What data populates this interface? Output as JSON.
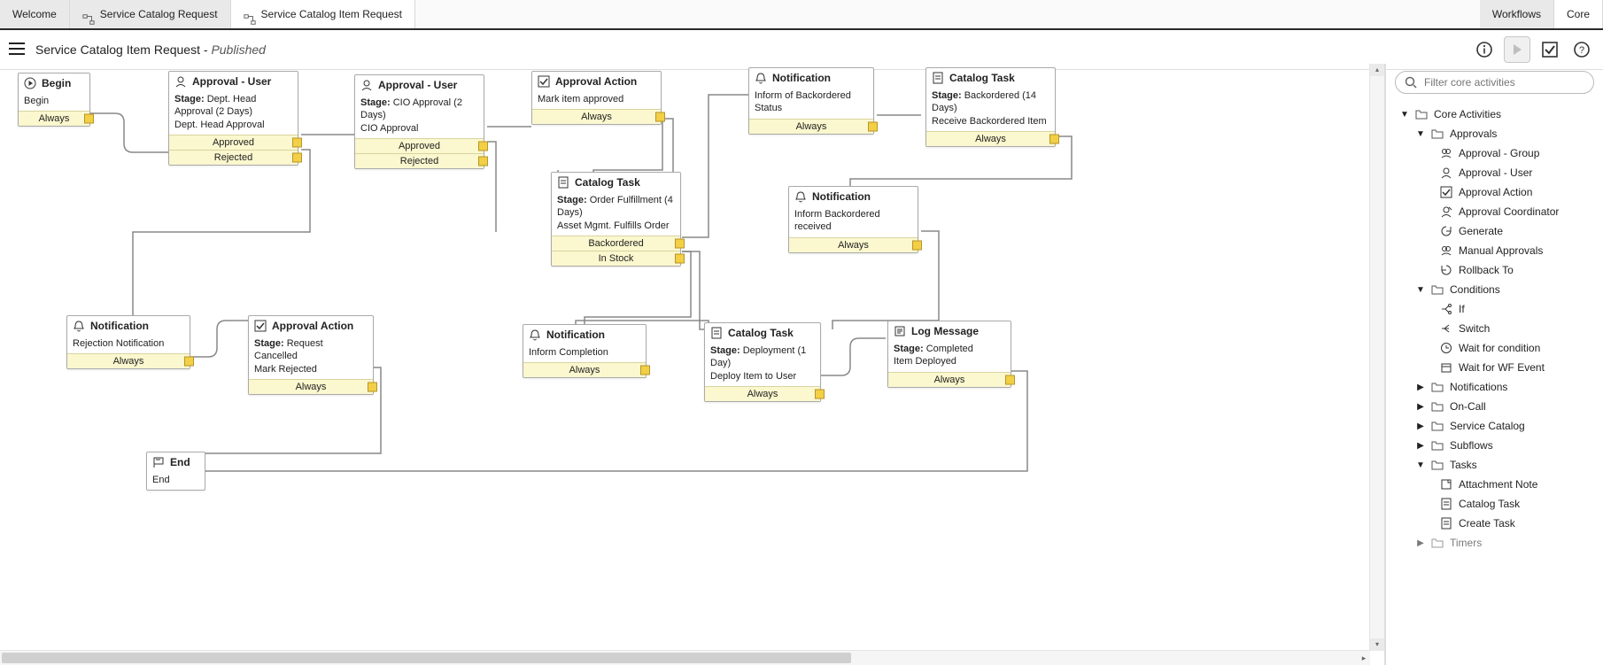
{
  "top_tabs": {
    "welcome": "Welcome",
    "scr": "Service Catalog Request",
    "scir": "Service Catalog Item Request"
  },
  "right_tabs": {
    "workflows": "Workflows",
    "core": "Core"
  },
  "toolbar": {
    "title": "Service Catalog Item Request",
    "status": "Published"
  },
  "side": {
    "search_placeholder": "Filter core activities",
    "root": "Core Activities",
    "approvals": {
      "label": "Approvals",
      "items": [
        "Approval - Group",
        "Approval - User",
        "Approval Action",
        "Approval Coordinator",
        "Generate",
        "Manual Approvals",
        "Rollback To"
      ]
    },
    "conditions": {
      "label": "Conditions",
      "items": [
        "If",
        "Switch",
        "Wait for condition",
        "Wait for WF Event"
      ]
    },
    "notifications": "Notifications",
    "oncall": "On-Call",
    "service_catalog": "Service Catalog",
    "subflows": "Subflows",
    "tasks": {
      "label": "Tasks",
      "items": [
        "Attachment Note",
        "Catalog Task",
        "Create Task"
      ]
    },
    "timers": "Timers"
  },
  "labels": {
    "stage": "Stage:",
    "always": "Always",
    "approved": "Approved",
    "rejected": "Rejected",
    "backordered": "Backordered",
    "instock": "In Stock"
  },
  "nodes": {
    "begin": {
      "title": "Begin",
      "desc": "Begin"
    },
    "apr_user1": {
      "title": "Approval - User",
      "stage": "Dept. Head Approval (2 Days)",
      "desc": "Dept. Head Approval"
    },
    "apr_user2": {
      "title": "Approval - User",
      "stage": "CIO Approval (2 Days)",
      "desc": "CIO Approval"
    },
    "apr_action_mark": {
      "title": "Approval Action",
      "desc": "Mark item approved"
    },
    "notif_backordered": {
      "title": "Notification",
      "desc": "Inform of Backordered Status"
    },
    "cat_task_receive": {
      "title": "Catalog Task",
      "stage": "Backordered (14 Days)",
      "desc": "Receive Backordered Item"
    },
    "cat_task_fulfill": {
      "title": "Catalog Task",
      "stage": "Order Fulfillment (4 Days)",
      "desc": "Asset Mgmt. Fulfills Order"
    },
    "notif_received": {
      "title": "Notification",
      "desc": "Inform Backordered received"
    },
    "notif_reject": {
      "title": "Notification",
      "desc": "Rejection Notification"
    },
    "apr_action_cancel": {
      "title": "Approval Action",
      "stage": "Request Cancelled",
      "desc": "Mark Rejected"
    },
    "notif_complete": {
      "title": "Notification",
      "desc": "Inform Completion"
    },
    "cat_task_deploy": {
      "title": "Catalog Task",
      "stage": "Deployment (1 Day)",
      "desc": "Deploy Item to User"
    },
    "log_msg": {
      "title": "Log Message",
      "stage": "Completed",
      "desc": "Item Deployed"
    },
    "end": {
      "title": "End",
      "desc": "End"
    }
  }
}
